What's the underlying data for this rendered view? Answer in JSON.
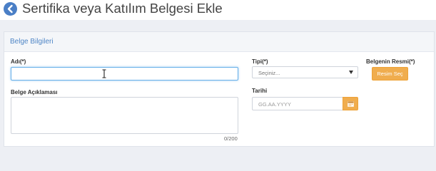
{
  "header": {
    "title": "Sertifika veya Katılım Belgesi Ekle"
  },
  "panel": {
    "title": "Belge Bilgileri"
  },
  "form": {
    "name_label": "Adı(*)",
    "name_value": "",
    "description_label": "Belge Açıklaması",
    "description_value": "",
    "char_count": "0/200",
    "type_label": "Tipi(*)",
    "type_selected": "Seçiniz...",
    "date_label": "Tarihi",
    "date_placeholder": "GG.AA.YYYY",
    "image_label": "Belgenin Resmi(*)",
    "image_button": "Resim Seç"
  },
  "icons": {
    "back": "back-arrow-icon",
    "calendar": "calendar-icon",
    "caret": "chevron-down-icon",
    "cursor": "text-cursor-icon"
  },
  "colors": {
    "accent_blue": "#4a7fc6",
    "panel_title": "#4f86c6",
    "warning_orange": "#f0ad4e",
    "focus_border": "#66afe9"
  }
}
